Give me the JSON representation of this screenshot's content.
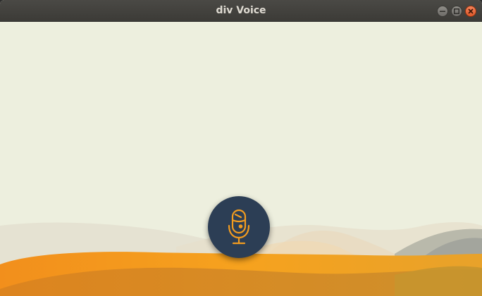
{
  "window": {
    "title": "div Voice"
  },
  "controls": {
    "minimize": "minimize-icon",
    "maximize": "maximize-icon",
    "close": "close-icon"
  },
  "mic_button": {
    "icon": "microphone-icon"
  },
  "colors": {
    "background": "#edefde",
    "accent_orange": "#f39c1f",
    "mic_button_bg": "#2c3e55",
    "mic_icon": "#f39c1f"
  }
}
